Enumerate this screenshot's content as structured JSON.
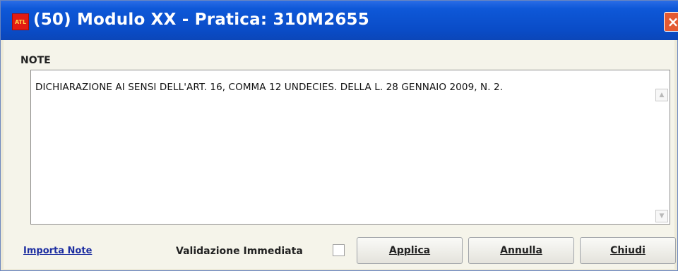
{
  "window": {
    "title": "(50) Modulo XX - Pratica: 310M2655",
    "close_glyph": "×"
  },
  "app_icon": {
    "text": "ATL"
  },
  "note": {
    "label": "NOTE",
    "text": "DICHIARAZIONE AI SENSI DELL'ART. 16, COMMA 12 UNDECIES. DELLA L. 28 GENNAIO 2009, N. 2."
  },
  "footer": {
    "import_link": "Importa Note",
    "validation_label": "Validazione Immediata",
    "validation_checked": false,
    "apply_label": "Applica",
    "cancel_label": "Annulla",
    "close_label": "Chiudi"
  },
  "colors": {
    "titlebar": "#0a4cc7",
    "link": "#1d2ea1",
    "close": "#e35a33"
  }
}
